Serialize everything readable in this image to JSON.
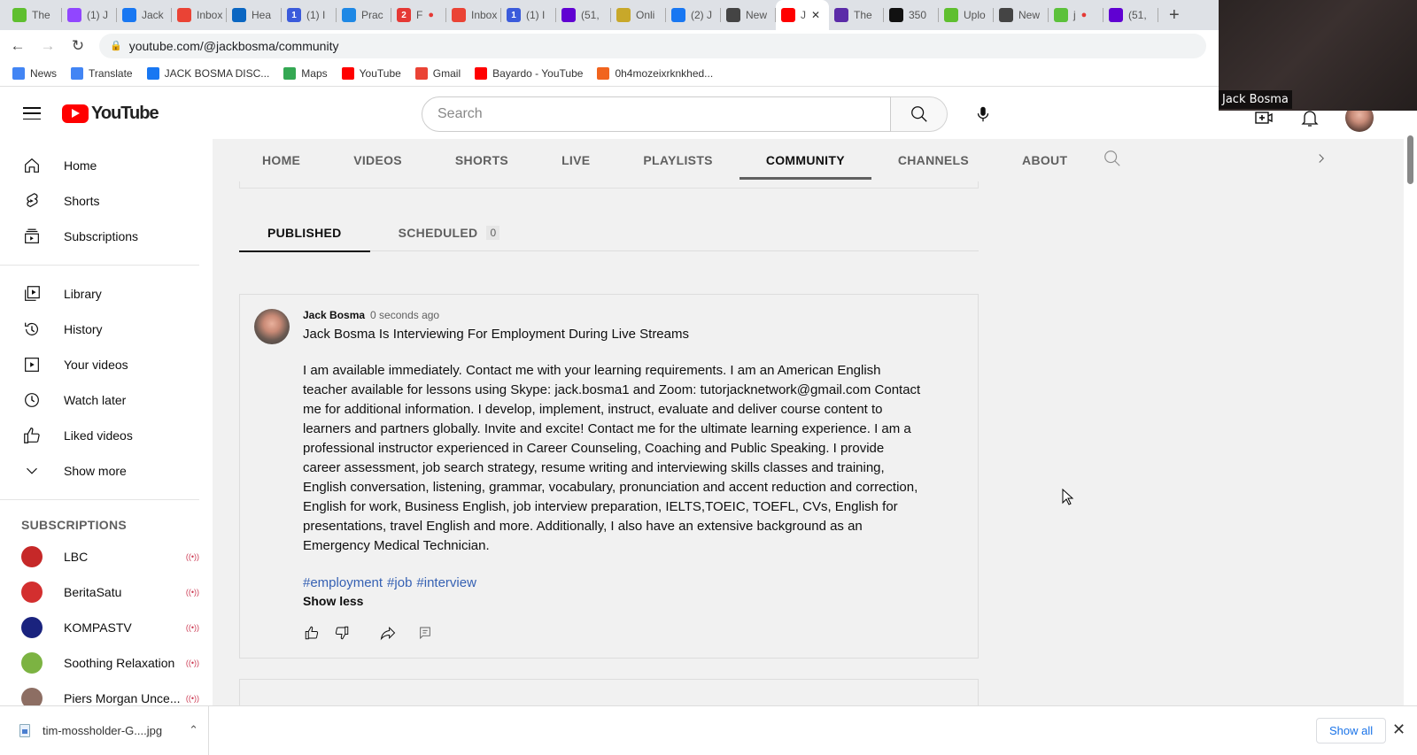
{
  "browser": {
    "tabs": [
      {
        "label": "The",
        "icon": "rumble-icon",
        "color": "#5fbf2f"
      },
      {
        "label": "(1) J",
        "icon": "twitch-icon",
        "color": "#9146ff"
      },
      {
        "label": "Jack",
        "icon": "facebook-icon",
        "color": "#1877f2"
      },
      {
        "label": "Inbox",
        "icon": "gmail-icon",
        "color": "#ea4335"
      },
      {
        "label": "Hea",
        "icon": "linkedin-icon",
        "color": "#0a66c2"
      },
      {
        "label": "(1) I",
        "icon": "gettr-icon",
        "color": "#3b5bdb",
        "badge": "1"
      },
      {
        "label": "Prac",
        "icon": "edge-icon",
        "color": "#1e88e5"
      },
      {
        "label": "F",
        "icon": "app-icon",
        "color": "#e53935",
        "badge": "2",
        "recording": true
      },
      {
        "label": "Inbox",
        "icon": "gmail-icon",
        "color": "#ea4335"
      },
      {
        "label": "(1) I",
        "icon": "gettr-icon",
        "color": "#3b5bdb",
        "badge": "1"
      },
      {
        "label": "(51,",
        "icon": "yahoo-mail-icon",
        "color": "#6001d2"
      },
      {
        "label": "Onli",
        "icon": "quiz-icon",
        "color": "#c8a82a"
      },
      {
        "label": "(2) J",
        "icon": "facebook-icon",
        "color": "#1877f2"
      },
      {
        "label": "New",
        "icon": "chrome-icon",
        "color": "#444444"
      },
      {
        "label": "J",
        "icon": "youtube-icon",
        "color": "#ff0000",
        "active": true
      },
      {
        "label": "The",
        "icon": "app-icon",
        "color": "#5b2ba8"
      },
      {
        "label": "350",
        "icon": "350-icon",
        "color": "#111111"
      },
      {
        "label": "Uplo",
        "icon": "rumble-icon",
        "color": "#5fbf2f"
      },
      {
        "label": "New",
        "icon": "chrome-icon",
        "color": "#444444"
      },
      {
        "label": "j",
        "icon": "m-icon",
        "color": "#5cc13b",
        "recording": true
      },
      {
        "label": "(51,",
        "icon": "yahoo-mail-icon",
        "color": "#6001d2"
      }
    ],
    "new_tab_label": "+",
    "url": "youtube.com/@jackbosma/community",
    "bookmarks": [
      {
        "label": "News",
        "icon": "google-news-icon",
        "color": "#4285f4"
      },
      {
        "label": "Translate",
        "icon": "google-translate-icon",
        "color": "#4285f4"
      },
      {
        "label": "JACK BOSMA DISC...",
        "icon": "facebook-icon",
        "color": "#1877f2"
      },
      {
        "label": "Maps",
        "icon": "google-maps-icon",
        "color": "#34a853"
      },
      {
        "label": "YouTube",
        "icon": "youtube-icon",
        "color": "#ff0000"
      },
      {
        "label": "Gmail",
        "icon": "gmail-icon",
        "color": "#ea4335"
      },
      {
        "label": "Bayardo - YouTube",
        "icon": "youtube-icon",
        "color": "#ff0000"
      },
      {
        "label": "0h4mozeixrknkhed...",
        "icon": "etsy-icon",
        "color": "#f1641e"
      }
    ]
  },
  "header": {
    "logo_text": "YouTube",
    "search_placeholder": "Search"
  },
  "sidebar": {
    "primary": [
      {
        "label": "Home",
        "icon": "home-icon"
      },
      {
        "label": "Shorts",
        "icon": "shorts-icon"
      },
      {
        "label": "Subscriptions",
        "icon": "subscriptions-icon"
      }
    ],
    "secondary": [
      {
        "label": "Library",
        "icon": "library-icon"
      },
      {
        "label": "History",
        "icon": "history-icon"
      },
      {
        "label": "Your videos",
        "icon": "your-videos-icon"
      },
      {
        "label": "Watch later",
        "icon": "watch-later-icon"
      },
      {
        "label": "Liked videos",
        "icon": "liked-videos-icon"
      },
      {
        "label": "Show more",
        "icon": "chevron-down-icon"
      }
    ],
    "subscriptions_heading": "SUBSCRIPTIONS",
    "subscriptions": [
      {
        "name": "LBC",
        "live": true,
        "color": "#c62828"
      },
      {
        "name": "BeritaSatu",
        "live": true,
        "color": "#d32f2f"
      },
      {
        "name": "KOMPASTV",
        "live": true,
        "color": "#1a237e"
      },
      {
        "name": "Soothing Relaxation",
        "live": true,
        "color": "#7cb342"
      },
      {
        "name": "Piers Morgan Unce...",
        "live": true,
        "color": "#8d6e63"
      }
    ]
  },
  "channel_tabs": [
    {
      "label": "HOME"
    },
    {
      "label": "VIDEOS"
    },
    {
      "label": "SHORTS"
    },
    {
      "label": "LIVE"
    },
    {
      "label": "PLAYLISTS"
    },
    {
      "label": "COMMUNITY",
      "active": true
    },
    {
      "label": "CHANNELS"
    },
    {
      "label": "ABOUT"
    }
  ],
  "community": {
    "tabs": [
      {
        "label": "PUBLISHED",
        "active": true
      },
      {
        "label": "SCHEDULED",
        "count": "0"
      }
    ],
    "post": {
      "author": "Jack Bosma",
      "time": "0 seconds ago",
      "title": "Jack Bosma Is Interviewing For Employment During Live Streams",
      "body": "I am available immediately. Contact me with your learning requirements. I am an American English teacher available for lessons using Skype: jack.bosma1 and Zoom: tutorjacknetwork@gmail.com Contact me for additional information. I develop, implement, instruct, evaluate and deliver course content to learners and partners globally. Invite and excite! Contact me for the ultimate learning experience. I am a professional instructor experienced in Career Counseling, Coaching and Public Speaking. I provide career assessment, job search strategy, resume writing and interviewing skills classes and training, English conversation, listening, grammar, vocabulary, pronunciation and accent reduction and correction, English for work, Business English, job interview preparation, IELTS,TOEIC, TOEFL, CVs, English for presentations, travel English and more. Additionally, I also have an extensive background as an Emergency Medical Technician.",
      "hashtags": [
        "#employment",
        "#job",
        "#interview"
      ],
      "show_less": "Show less"
    }
  },
  "downloads": {
    "file": "tim-mossholder-G....jpg",
    "show_all": "Show all"
  },
  "video_overlay": {
    "name": "Jack Bosma"
  }
}
